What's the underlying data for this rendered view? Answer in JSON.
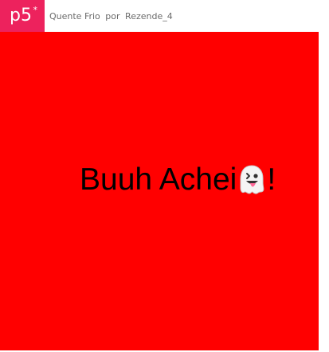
{
  "header": {
    "logo_text": "p5",
    "logo_asterisk": "*",
    "sketch_name": "Quente Frio",
    "by_word": "por",
    "author": "Rezende_4"
  },
  "canvas": {
    "background_color": "#ff0000",
    "message_before": "Buuh Achei",
    "message_icon": "ghost-icon",
    "message_after": "!"
  },
  "colors": {
    "brand": "#ed225d",
    "canvas": "#ff0000",
    "text": "#000000"
  }
}
